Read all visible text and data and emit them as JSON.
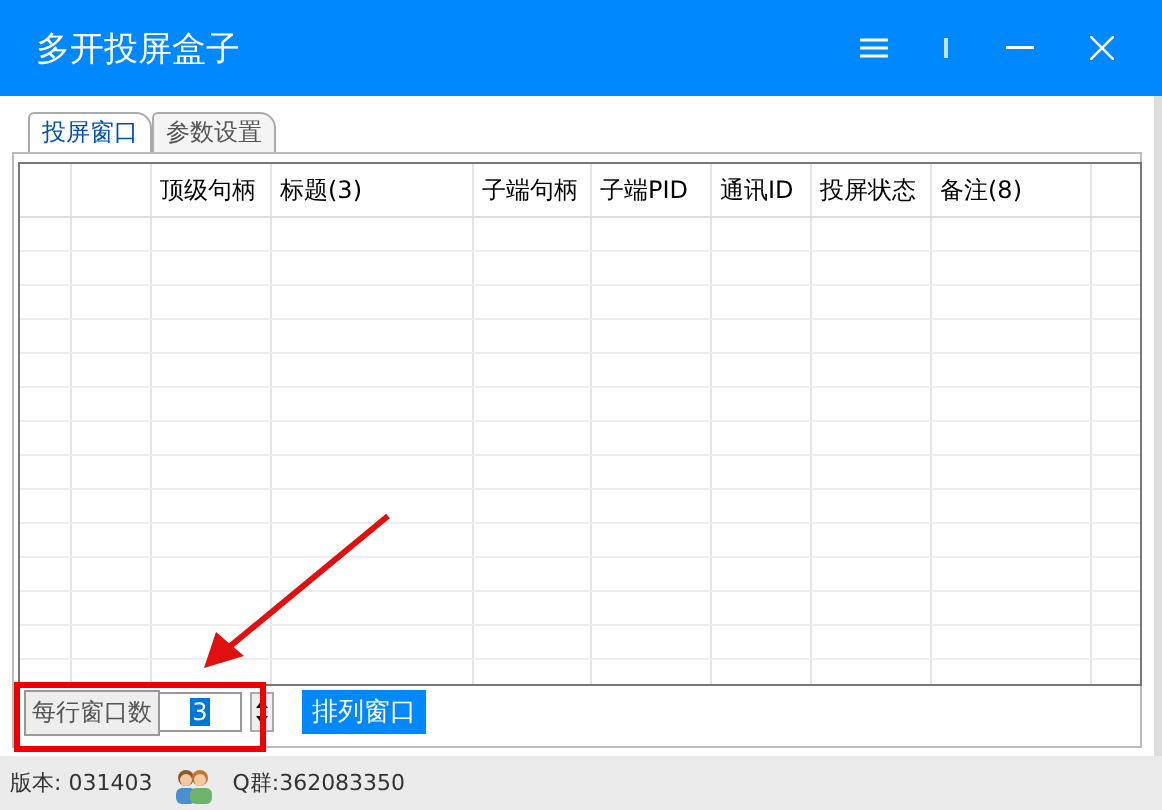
{
  "window": {
    "title": "多开投屏盒子"
  },
  "tabs": [
    {
      "label": "投屏窗口",
      "selected": true
    },
    {
      "label": "参数设置",
      "selected": false
    }
  ],
  "table": {
    "columns": [
      "顶级句柄",
      "标题(3)",
      "子端句柄",
      "子端PID",
      "通讯ID",
      "投屏状态",
      "备注(8)"
    ]
  },
  "spinner": {
    "label": "每行窗口数",
    "value": "3",
    "value_highlighted": true
  },
  "arrange_button": "排列窗口",
  "status_bar": {
    "version": "版本: 031403",
    "group": "Q群:362083350"
  }
}
